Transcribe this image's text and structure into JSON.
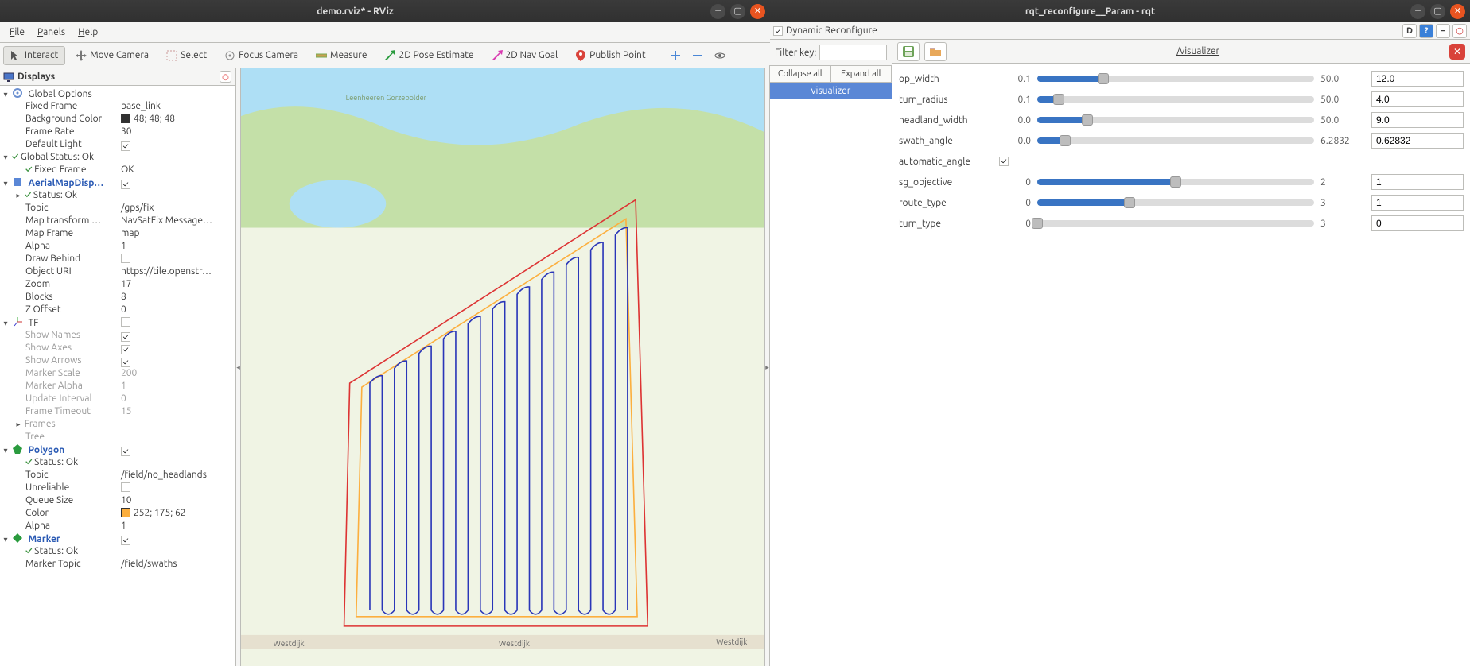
{
  "rviz": {
    "title": "demo.rviz* - RViz",
    "menu": {
      "file": "File",
      "panels": "Panels",
      "help": "Help"
    },
    "toolbar": {
      "interact": "Interact",
      "move_camera": "Move Camera",
      "select": "Select",
      "focus_camera": "Focus Camera",
      "measure": "Measure",
      "pose_estimate": "2D Pose Estimate",
      "nav_goal": "2D Nav Goal",
      "publish_point": "Publish Point"
    },
    "displays_hdr": "Displays",
    "tree": {
      "global_options": {
        "lbl": "Global Options"
      },
      "fixed_frame": {
        "lbl": "Fixed Frame",
        "val": "base_link"
      },
      "bg_color": {
        "lbl": "Background Color",
        "val": "48; 48; 48"
      },
      "frame_rate": {
        "lbl": "Frame Rate",
        "val": "30"
      },
      "default_light": {
        "lbl": "Default Light",
        "chk": true
      },
      "global_status": {
        "lbl": "Global Status: Ok"
      },
      "gs_fixed_frame": {
        "lbl": "Fixed Frame",
        "val": "OK"
      },
      "aerial": {
        "lbl": "AerialMapDisp…",
        "chk": true
      },
      "aerial_status": {
        "lbl": "Status: Ok"
      },
      "aerial_topic": {
        "lbl": "Topic",
        "val": "/gps/fix"
      },
      "map_transform": {
        "lbl": "Map transform …",
        "val": "NavSatFix Message…"
      },
      "map_frame": {
        "lbl": "Map Frame",
        "val": "map"
      },
      "a_alpha": {
        "lbl": "Alpha",
        "val": "1"
      },
      "draw_behind": {
        "lbl": "Draw Behind",
        "chk": false
      },
      "obj_uri": {
        "lbl": "Object URI",
        "val": "https://tile.openstr…"
      },
      "zoom": {
        "lbl": "Zoom",
        "val": "17"
      },
      "blocks": {
        "lbl": "Blocks",
        "val": "8"
      },
      "z_offset": {
        "lbl": "Z Offset",
        "val": "0"
      },
      "tf": {
        "lbl": "TF",
        "chk": false
      },
      "show_names": {
        "lbl": "Show Names",
        "chk": true
      },
      "show_axes": {
        "lbl": "Show Axes",
        "chk": true
      },
      "show_arrows": {
        "lbl": "Show Arrows",
        "chk": true
      },
      "marker_scale": {
        "lbl": "Marker Scale",
        "val": "200"
      },
      "marker_alpha": {
        "lbl": "Marker Alpha",
        "val": "1"
      },
      "update_interval": {
        "lbl": "Update Interval",
        "val": "0"
      },
      "frame_timeout": {
        "lbl": "Frame Timeout",
        "val": "15"
      },
      "frames": {
        "lbl": "Frames"
      },
      "tree_sub": {
        "lbl": "Tree"
      },
      "polygon": {
        "lbl": "Polygon",
        "chk": true
      },
      "poly_status": {
        "lbl": "Status: Ok"
      },
      "poly_topic": {
        "lbl": "Topic",
        "val": "/field/no_headlands"
      },
      "unreliable": {
        "lbl": "Unreliable",
        "chk": false
      },
      "queue": {
        "lbl": "Queue Size",
        "val": "10"
      },
      "poly_color": {
        "lbl": "Color",
        "val": "252; 175; 62"
      },
      "poly_alpha": {
        "lbl": "Alpha",
        "val": "1"
      },
      "marker": {
        "lbl": "Marker",
        "chk": true
      },
      "mk_status": {
        "lbl": "Status: Ok"
      },
      "mk_topic": {
        "lbl": "Marker Topic",
        "val": "/field/swaths"
      }
    },
    "map_labels": {
      "westdijk": "Westdijk",
      "polder": "Leenheeren Gorzepolder"
    }
  },
  "rqt": {
    "title": "rqt_reconfigure__Param - rqt",
    "sub_title": "Dynamic Reconfigure",
    "sub_d": "D",
    "filter_label": "Filter key:",
    "collapse": "Collapse all",
    "expand": "Expand all",
    "node": "visualizer",
    "panel_title": "/visualizer",
    "params": {
      "op_width": {
        "lbl": "op_width",
        "min": "0.1",
        "max": "50.0",
        "val": "12.0",
        "pct": 23.8
      },
      "turn_radius": {
        "lbl": "turn_radius",
        "min": "0.1",
        "max": "50.0",
        "val": "4.0",
        "pct": 7.8
      },
      "headland_width": {
        "lbl": "headland_width",
        "min": "0.0",
        "max": "50.0",
        "val": "9.0",
        "pct": 18.0
      },
      "swath_angle": {
        "lbl": "swath_angle",
        "min": "0.0",
        "max": "6.2832",
        "val": "0.62832",
        "pct": 10.0
      },
      "automatic_angle": {
        "lbl": "automatic_angle",
        "chk": true
      },
      "sg_objective": {
        "lbl": "sg_objective",
        "min": "0",
        "max": "2",
        "val": "1",
        "pct": 50.0
      },
      "route_type": {
        "lbl": "route_type",
        "min": "0",
        "max": "3",
        "val": "1",
        "pct": 33.3
      },
      "turn_type": {
        "lbl": "turn_type",
        "min": "0",
        "max": "3",
        "val": "0",
        "pct": 0.0
      }
    }
  }
}
